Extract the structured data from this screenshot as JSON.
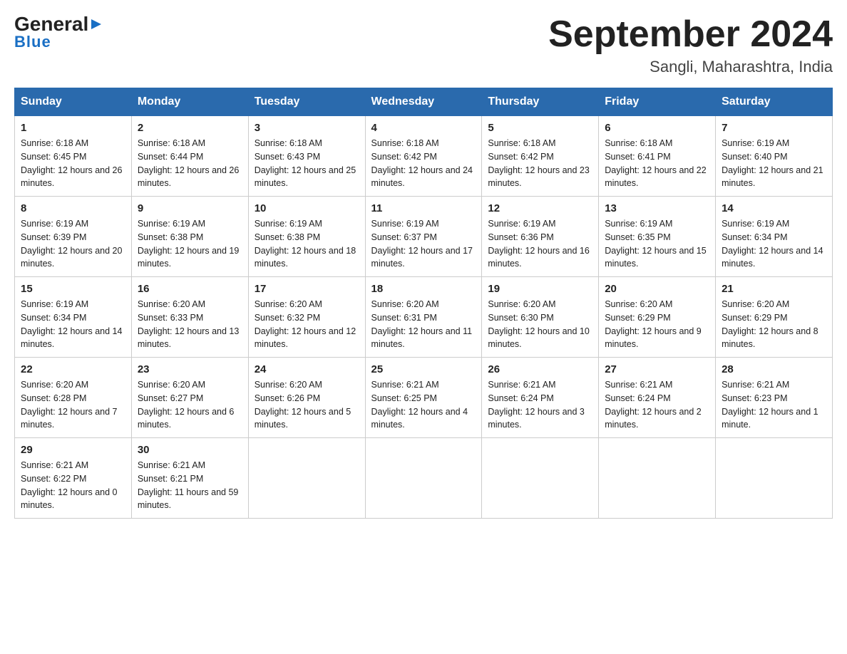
{
  "header": {
    "logo_general": "General",
    "logo_blue": "Blue",
    "month_title": "September 2024",
    "location": "Sangli, Maharashtra, India"
  },
  "weekdays": [
    "Sunday",
    "Monday",
    "Tuesday",
    "Wednesday",
    "Thursday",
    "Friday",
    "Saturday"
  ],
  "weeks": [
    [
      {
        "day": "1",
        "sunrise": "Sunrise: 6:18 AM",
        "sunset": "Sunset: 6:45 PM",
        "daylight": "Daylight: 12 hours and 26 minutes."
      },
      {
        "day": "2",
        "sunrise": "Sunrise: 6:18 AM",
        "sunset": "Sunset: 6:44 PM",
        "daylight": "Daylight: 12 hours and 26 minutes."
      },
      {
        "day": "3",
        "sunrise": "Sunrise: 6:18 AM",
        "sunset": "Sunset: 6:43 PM",
        "daylight": "Daylight: 12 hours and 25 minutes."
      },
      {
        "day": "4",
        "sunrise": "Sunrise: 6:18 AM",
        "sunset": "Sunset: 6:42 PM",
        "daylight": "Daylight: 12 hours and 24 minutes."
      },
      {
        "day": "5",
        "sunrise": "Sunrise: 6:18 AM",
        "sunset": "Sunset: 6:42 PM",
        "daylight": "Daylight: 12 hours and 23 minutes."
      },
      {
        "day": "6",
        "sunrise": "Sunrise: 6:18 AM",
        "sunset": "Sunset: 6:41 PM",
        "daylight": "Daylight: 12 hours and 22 minutes."
      },
      {
        "day": "7",
        "sunrise": "Sunrise: 6:19 AM",
        "sunset": "Sunset: 6:40 PM",
        "daylight": "Daylight: 12 hours and 21 minutes."
      }
    ],
    [
      {
        "day": "8",
        "sunrise": "Sunrise: 6:19 AM",
        "sunset": "Sunset: 6:39 PM",
        "daylight": "Daylight: 12 hours and 20 minutes."
      },
      {
        "day": "9",
        "sunrise": "Sunrise: 6:19 AM",
        "sunset": "Sunset: 6:38 PM",
        "daylight": "Daylight: 12 hours and 19 minutes."
      },
      {
        "day": "10",
        "sunrise": "Sunrise: 6:19 AM",
        "sunset": "Sunset: 6:38 PM",
        "daylight": "Daylight: 12 hours and 18 minutes."
      },
      {
        "day": "11",
        "sunrise": "Sunrise: 6:19 AM",
        "sunset": "Sunset: 6:37 PM",
        "daylight": "Daylight: 12 hours and 17 minutes."
      },
      {
        "day": "12",
        "sunrise": "Sunrise: 6:19 AM",
        "sunset": "Sunset: 6:36 PM",
        "daylight": "Daylight: 12 hours and 16 minutes."
      },
      {
        "day": "13",
        "sunrise": "Sunrise: 6:19 AM",
        "sunset": "Sunset: 6:35 PM",
        "daylight": "Daylight: 12 hours and 15 minutes."
      },
      {
        "day": "14",
        "sunrise": "Sunrise: 6:19 AM",
        "sunset": "Sunset: 6:34 PM",
        "daylight": "Daylight: 12 hours and 14 minutes."
      }
    ],
    [
      {
        "day": "15",
        "sunrise": "Sunrise: 6:19 AM",
        "sunset": "Sunset: 6:34 PM",
        "daylight": "Daylight: 12 hours and 14 minutes."
      },
      {
        "day": "16",
        "sunrise": "Sunrise: 6:20 AM",
        "sunset": "Sunset: 6:33 PM",
        "daylight": "Daylight: 12 hours and 13 minutes."
      },
      {
        "day": "17",
        "sunrise": "Sunrise: 6:20 AM",
        "sunset": "Sunset: 6:32 PM",
        "daylight": "Daylight: 12 hours and 12 minutes."
      },
      {
        "day": "18",
        "sunrise": "Sunrise: 6:20 AM",
        "sunset": "Sunset: 6:31 PM",
        "daylight": "Daylight: 12 hours and 11 minutes."
      },
      {
        "day": "19",
        "sunrise": "Sunrise: 6:20 AM",
        "sunset": "Sunset: 6:30 PM",
        "daylight": "Daylight: 12 hours and 10 minutes."
      },
      {
        "day": "20",
        "sunrise": "Sunrise: 6:20 AM",
        "sunset": "Sunset: 6:29 PM",
        "daylight": "Daylight: 12 hours and 9 minutes."
      },
      {
        "day": "21",
        "sunrise": "Sunrise: 6:20 AM",
        "sunset": "Sunset: 6:29 PM",
        "daylight": "Daylight: 12 hours and 8 minutes."
      }
    ],
    [
      {
        "day": "22",
        "sunrise": "Sunrise: 6:20 AM",
        "sunset": "Sunset: 6:28 PM",
        "daylight": "Daylight: 12 hours and 7 minutes."
      },
      {
        "day": "23",
        "sunrise": "Sunrise: 6:20 AM",
        "sunset": "Sunset: 6:27 PM",
        "daylight": "Daylight: 12 hours and 6 minutes."
      },
      {
        "day": "24",
        "sunrise": "Sunrise: 6:20 AM",
        "sunset": "Sunset: 6:26 PM",
        "daylight": "Daylight: 12 hours and 5 minutes."
      },
      {
        "day": "25",
        "sunrise": "Sunrise: 6:21 AM",
        "sunset": "Sunset: 6:25 PM",
        "daylight": "Daylight: 12 hours and 4 minutes."
      },
      {
        "day": "26",
        "sunrise": "Sunrise: 6:21 AM",
        "sunset": "Sunset: 6:24 PM",
        "daylight": "Daylight: 12 hours and 3 minutes."
      },
      {
        "day": "27",
        "sunrise": "Sunrise: 6:21 AM",
        "sunset": "Sunset: 6:24 PM",
        "daylight": "Daylight: 12 hours and 2 minutes."
      },
      {
        "day": "28",
        "sunrise": "Sunrise: 6:21 AM",
        "sunset": "Sunset: 6:23 PM",
        "daylight": "Daylight: 12 hours and 1 minute."
      }
    ],
    [
      {
        "day": "29",
        "sunrise": "Sunrise: 6:21 AM",
        "sunset": "Sunset: 6:22 PM",
        "daylight": "Daylight: 12 hours and 0 minutes."
      },
      {
        "day": "30",
        "sunrise": "Sunrise: 6:21 AM",
        "sunset": "Sunset: 6:21 PM",
        "daylight": "Daylight: 11 hours and 59 minutes."
      },
      null,
      null,
      null,
      null,
      null
    ]
  ]
}
